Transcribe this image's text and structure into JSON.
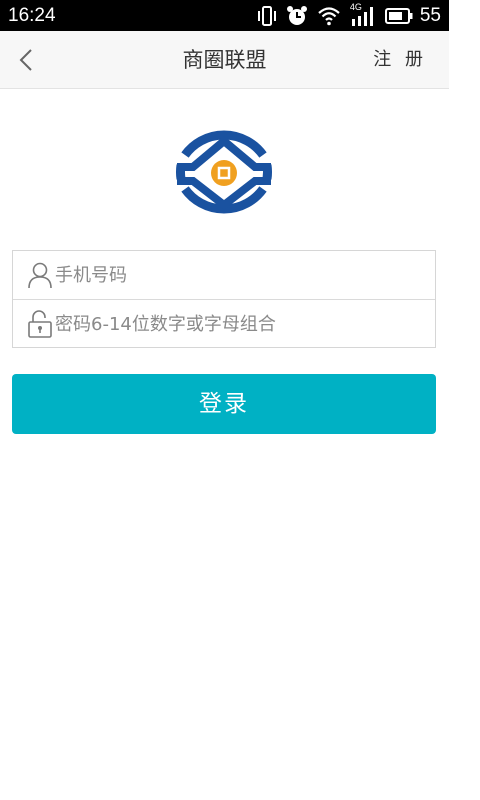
{
  "status_bar": {
    "time": "16:24",
    "battery_level": "55",
    "network_type": "4G",
    "icons": [
      "vibrate-icon",
      "alarm-icon",
      "wifi-icon",
      "signal-4g-icon",
      "battery-icon"
    ]
  },
  "nav": {
    "title": "商圈联盟",
    "register_label": "注 册",
    "back_icon": "chevron-left-icon"
  },
  "logo": {
    "icon": "logo-emblem-icon",
    "colors": {
      "blue": "#1a52a0",
      "gold": "#f0a020"
    }
  },
  "form": {
    "phone": {
      "placeholder": "手机号码",
      "value": "",
      "icon": "user-icon"
    },
    "password": {
      "placeholder": "密码6-14位数字或字母组合",
      "value": "",
      "icon": "lock-icon"
    }
  },
  "login_button": {
    "label": "登录",
    "color": "#00b1c4"
  }
}
